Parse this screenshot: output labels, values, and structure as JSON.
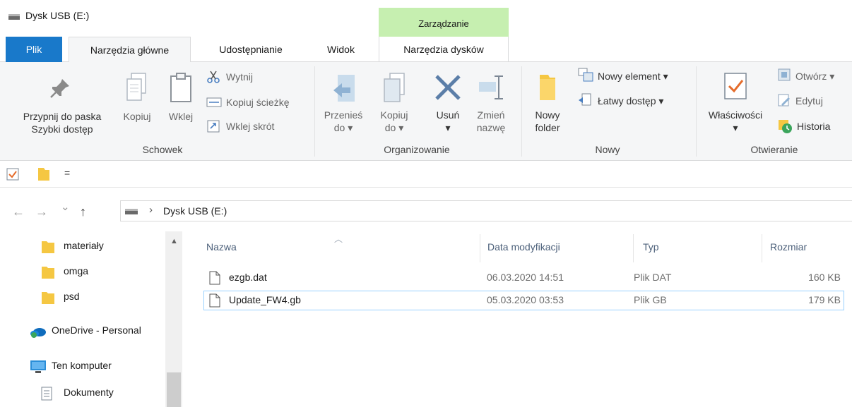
{
  "window": {
    "title": "Dysk USB (E:)",
    "context_tab_title": "Zarządzanie"
  },
  "tabs": [
    {
      "label": "Plik"
    },
    {
      "label": "Narzędzia główne"
    },
    {
      "label": "Udostępnianie"
    },
    {
      "label": "Widok"
    },
    {
      "label": "Narzędzia dysków"
    }
  ],
  "ribbon": {
    "schowek": {
      "group_label": "Schowek",
      "pin_line1": "Przypnij do paska",
      "pin_line2": "Szybki dostęp",
      "copy": "Kopiuj",
      "paste": "Wklej",
      "cut": "Wytnij",
      "copy_path": "Kopiuj ścieżkę",
      "paste_shortcut": "Wklej skrót"
    },
    "organizowanie": {
      "group_label": "Organizowanie",
      "move_line1": "Przenieś",
      "move_line2": "do ▾",
      "copy_line1": "Kopiuj",
      "copy_line2": "do ▾",
      "delete_line1": "Usuń",
      "delete_line2": "▾",
      "rename_line1": "Zmień",
      "rename_line2": "nazwę"
    },
    "nowy": {
      "group_label": "Nowy",
      "new_folder_line1": "Nowy",
      "new_folder_line2": "folder",
      "new_item": "Nowy element ▾",
      "easy_access": "Łatwy dostęp ▾"
    },
    "otwieranie": {
      "group_label": "Otwieranie",
      "properties_line1": "Właściwości",
      "properties_line2": "▾",
      "open": "Otwórz ▾",
      "edit": "Edytuj",
      "history": "Historia"
    }
  },
  "qat": {
    "dropdown": "="
  },
  "address": {
    "back": "←",
    "forward": "→",
    "recent": "⌄",
    "up": "↑",
    "chevron": "›",
    "path": "Dysk USB (E:)"
  },
  "nav_pane": {
    "items": [
      {
        "label": "materiały"
      },
      {
        "label": "omga"
      },
      {
        "label": "psd"
      },
      {
        "label": "OneDrive - Personal"
      },
      {
        "label": "Ten komputer"
      },
      {
        "label": "Dokumenty"
      }
    ]
  },
  "file_list": {
    "columns": {
      "name": "Nazwa",
      "modified": "Data modyfikacji",
      "type": "Typ",
      "size": "Rozmiar"
    },
    "rows": [
      {
        "name": "ezgb.dat",
        "modified": "06.03.2020 14:51",
        "type": "Plik DAT",
        "size": "160 KB"
      },
      {
        "name": "Update_FW4.gb",
        "modified": "05.03.2020 03:53",
        "type": "Plik GB",
        "size": "179 KB"
      }
    ]
  }
}
